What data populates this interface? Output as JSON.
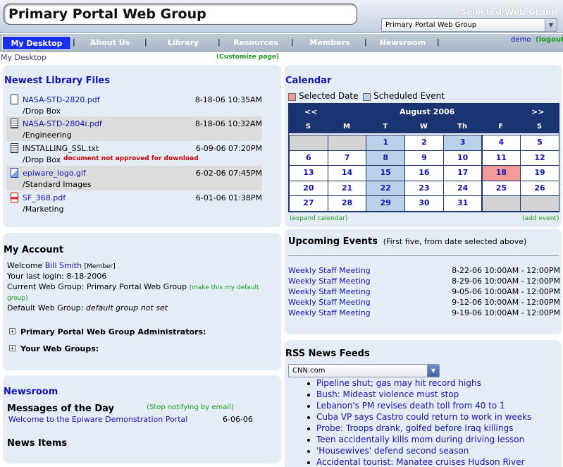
{
  "header": {
    "site_title": "Primary Portal Web Group",
    "selected_group_label": "Selected Web Group",
    "selected_group_value": "Primary Portal Web Group"
  },
  "nav": {
    "tabs": [
      "My Desktop",
      "About Us",
      "Library",
      "Resources",
      "Members",
      "Newsroom"
    ],
    "user": "demo",
    "logout": "(logout)"
  },
  "subheader": {
    "breadcrumb": "My Desktop",
    "customize": "(Customize page)"
  },
  "library": {
    "title": "Newest Library Files",
    "files": [
      {
        "name": "NASA-STD-2820.pdf",
        "date": "8-18-06 10:35AM",
        "path": "/Drop Box",
        "linked": true,
        "icon": "document-icon"
      },
      {
        "name": "NASA-STD-2804i.pdf",
        "date": "8-18-06 10:32AM",
        "path": "/Engineering",
        "linked": true,
        "icon": "text-document-icon"
      },
      {
        "name": "INSTALLING_SSL.txt",
        "date": "6-09-06 07:20PM",
        "path": "/Drop Box",
        "linked": false,
        "icon": "text-document-icon",
        "note": "document not approved for download"
      },
      {
        "name": "epiware_logo.gif",
        "date": "6-02-06 07:45PM",
        "path": "/Standard Images",
        "linked": true,
        "icon": "image-file-icon"
      },
      {
        "name": "SF_368.pdf",
        "date": "6-01-06 01:38PM",
        "path": "/Marketing",
        "linked": true,
        "icon": "pdf-file-icon"
      }
    ]
  },
  "account": {
    "title": "My Account",
    "welcome_prefix": "Welcome",
    "user_name": "Bill Smith",
    "user_role": "[Member]",
    "last_login": "Your last login: 8-18-2006",
    "current_group": "Current Web Group: Primary Portal Web Group",
    "make_default": "(make this my default group)",
    "default_group_prefix": "Default Web Group:",
    "default_group_value": "default group not set",
    "sections": [
      "Primary Portal Web Group Administrators:",
      "Your Web Groups:"
    ]
  },
  "newsroom": {
    "title": "Newsroom",
    "messages_title": "Messages of the Day",
    "stop_notify": "(Stop notifying by email)",
    "message": "Welcome to the Epiware Demonstration Portal",
    "message_date": "6-06-06",
    "news_items_title": "News Items"
  },
  "calendar": {
    "title": "Calendar",
    "legend_selected": "Selected Date",
    "legend_scheduled": "Scheduled Event",
    "prev": "<<",
    "next": ">>",
    "month": "August 2006",
    "weekdays": [
      "S",
      "M",
      "T",
      "W",
      "Th",
      "F",
      "S"
    ],
    "weeks": [
      [
        "",
        "",
        "1",
        "2",
        "3",
        "4",
        "5"
      ],
      [
        "6",
        "7",
        "8",
        "9",
        "10",
        "11",
        "12"
      ],
      [
        "13",
        "14",
        "15",
        "16",
        "17",
        "18",
        "19"
      ],
      [
        "20",
        "21",
        "22",
        "23",
        "24",
        "25",
        "26"
      ],
      [
        "27",
        "28",
        "29",
        "30",
        "31",
        "",
        ""
      ]
    ],
    "scheduled_days": [
      "1",
      "3",
      "8",
      "15",
      "22",
      "29"
    ],
    "selected_day": "18",
    "expand": "(expand calendar)",
    "add_event": "(add event)",
    "colors": {
      "header": "#1a3371",
      "selected": "#f29b9b",
      "scheduled": "#bcd0ea",
      "empty": "#d4d4d4"
    }
  },
  "events": {
    "title": "Upcoming Events",
    "subtitle": "(First five, from date selected above)",
    "items": [
      {
        "name": "Weekly Staff Meeting",
        "time": "8-22-06 10:00AM - 12:00PM"
      },
      {
        "name": "Weekly Staff Meeting",
        "time": "8-29-06 10:00AM - 12:00PM"
      },
      {
        "name": "Weekly Staff Meeting",
        "time": "9-05-06 10:00AM - 12:00PM"
      },
      {
        "name": "Weekly Staff Meeting",
        "time": "9-12-06 10:00AM - 12:00PM"
      },
      {
        "name": "Weekly Staff Meeting",
        "time": "9-19-06 10:00AM - 12:00PM"
      }
    ]
  },
  "rss": {
    "title": "RSS News Feeds",
    "feed": "CNN.com",
    "headlines": [
      "Pipeline shut; gas may hit record highs",
      "Bush: Mideast violence must stop",
      "Lebanon's PM revises death toll from 40 to 1",
      "Cuba VP says Castro could return to work in weeks",
      "Probe: Troops drank, golfed before Iraq killings",
      "Teen accidentally kills mom during driving lesson",
      "'Housewives' defend second season",
      "Accidental tourist: Manatee cruises Hudson River"
    ]
  },
  "colors": {
    "accent": "#1414b4",
    "active_tab": "#1a2ef0",
    "panel": "#e4ecf5",
    "green": "#1d9a1d",
    "warning": "#cc0000"
  }
}
